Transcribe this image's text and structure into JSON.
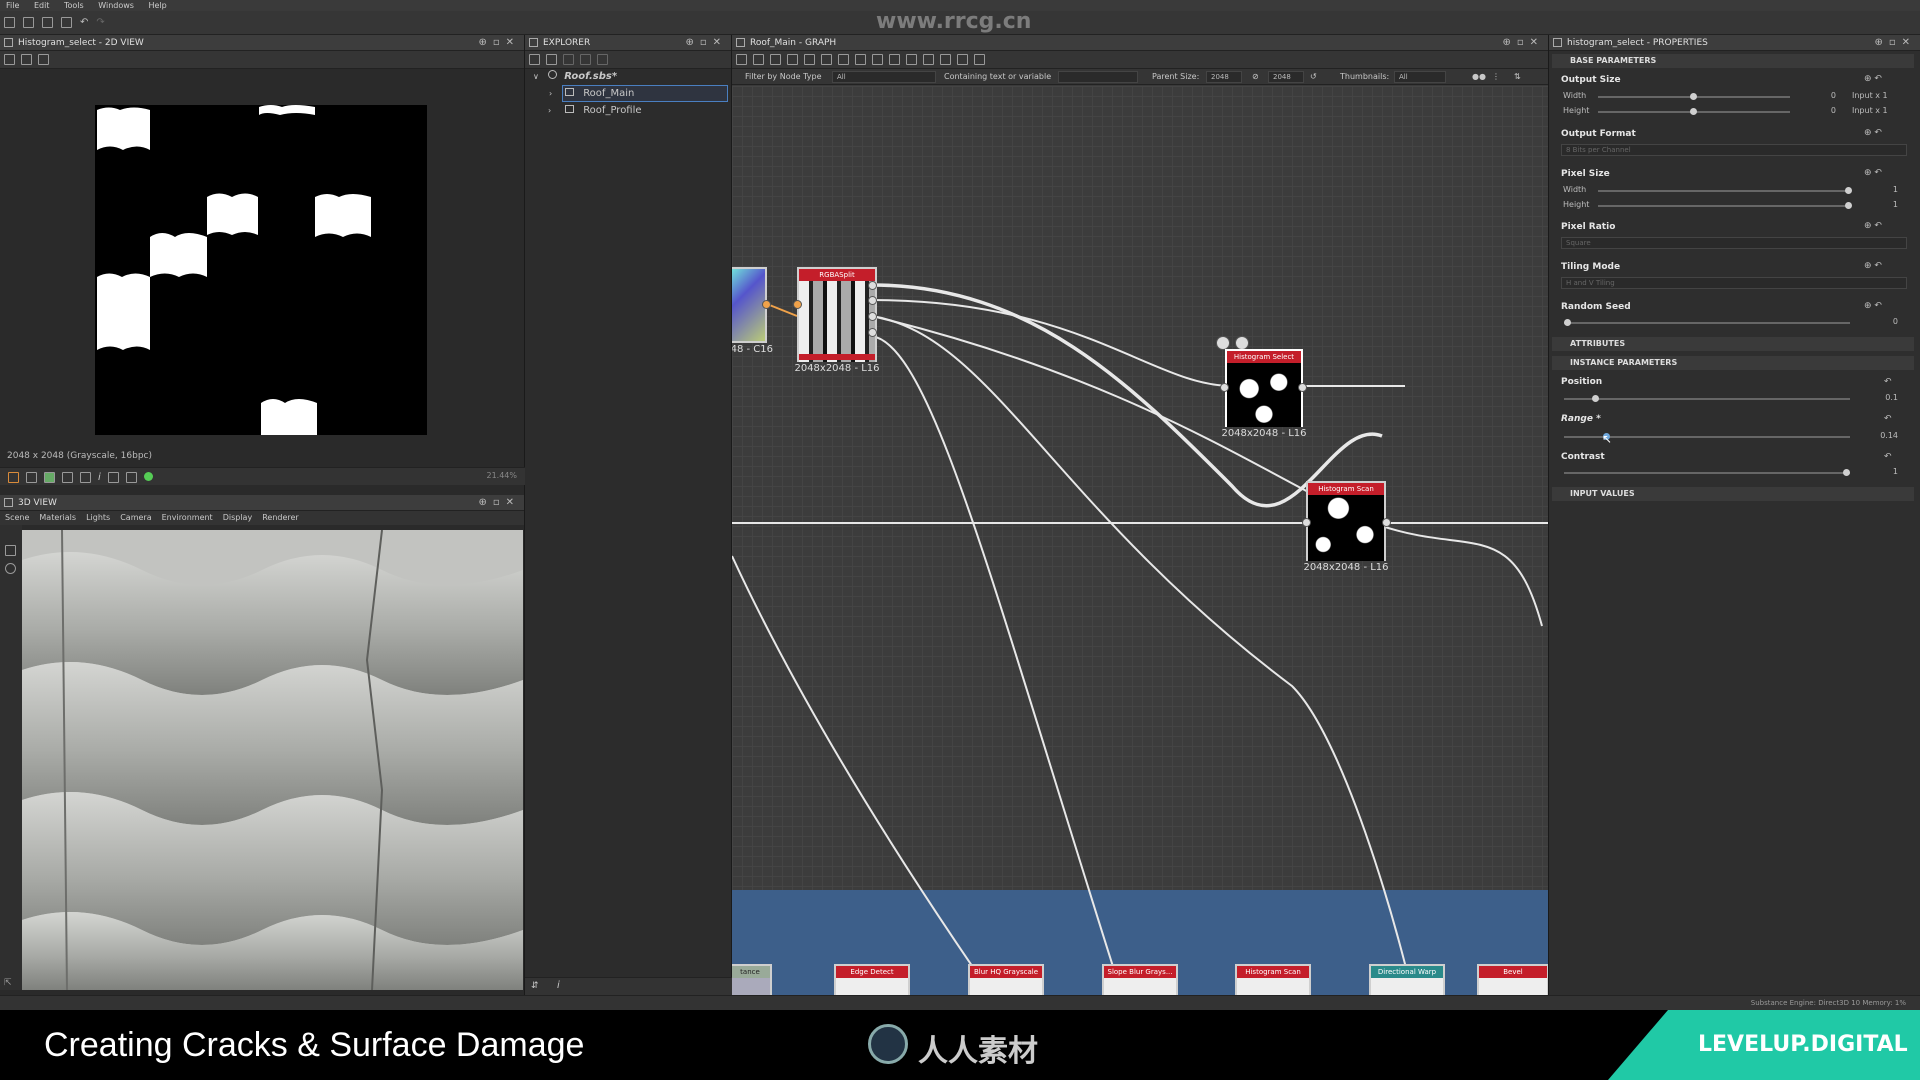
{
  "menu": [
    "File",
    "Edit",
    "Tools",
    "Windows",
    "Help"
  ],
  "watermark_site": "www.rrcg.cn",
  "view2d": {
    "title": "Histogram_select - 2D VIEW",
    "status": "2048 x 2048 (Grayscale, 16bpc)",
    "zoom": "21.44%"
  },
  "explorer": {
    "title": "EXPLORER",
    "package": "Roof.sbs*",
    "items": [
      "Roof_Main",
      "Roof_Profile"
    ]
  },
  "graph": {
    "title": "Roof_Main - GRAPH",
    "filter_label": "Filter by Node Type",
    "filter_value": "All",
    "containing_label": "Containing text or variable",
    "parent_size_label": "Parent Size:",
    "parent_size_w": "2048",
    "parent_size_h": "2048",
    "thumbnails_label": "Thumbnails:",
    "thumbnails_value": "All",
    "nodes": {
      "partial_left_label": "48 - C16",
      "rgbasplit": {
        "title": "RGBASplit",
        "label": "2048x2048 - L16"
      },
      "histogram_select": {
        "title": "Histogram Select",
        "label": "2048x2048 - L16"
      },
      "histogram_scan": {
        "title": "Histogram Scan",
        "label": "2048x2048 - L16"
      }
    },
    "bottom_nodes": [
      "tance",
      "Edge Detect",
      "Blur HQ Grayscale",
      "Slope Blur Grays...",
      "Histogram Scan",
      "Directional Warp",
      "Bevel"
    ]
  },
  "view3d": {
    "title": "3D VIEW",
    "menu": [
      "Scene",
      "Materials",
      "Lights",
      "Camera",
      "Environment",
      "Display",
      "Renderer"
    ]
  },
  "properties": {
    "title": "histogram_select - PROPERTIES",
    "sections": {
      "base": "BASE PARAMETERS",
      "attributes": "ATTRIBUTES",
      "instance": "INSTANCE PARAMETERS",
      "inputs": "INPUT VALUES"
    },
    "output_size": {
      "label": "Output Size",
      "width_label": "Width",
      "width_val": "0",
      "width_rel": "Input x 1",
      "height_label": "Height",
      "height_val": "0",
      "height_rel": "Input x 1"
    },
    "output_format": {
      "label": "Output Format",
      "value": "8 Bits per Channel"
    },
    "pixel_size": {
      "label": "Pixel Size",
      "width_label": "Width",
      "width_val": "1",
      "height_label": "Height",
      "height_val": "1"
    },
    "pixel_ratio": {
      "label": "Pixel Ratio",
      "value": "Square"
    },
    "tiling_mode": {
      "label": "Tiling Mode",
      "value": "H and V Tiling"
    },
    "random_seed": {
      "label": "Random Seed",
      "value": "0"
    },
    "instance": {
      "position_label": "Position",
      "position_val": "0.1",
      "position_level": 0.1,
      "range_label": "Range *",
      "range_val": "0.14",
      "range_level": 0.14,
      "contrast_label": "Contrast",
      "contrast_val": "1",
      "contrast_level": 1
    }
  },
  "statusbar": "Substance Engine: Direct3D 10  Memory: 1%",
  "banner": {
    "caption": "Creating Cracks & Surface Damage",
    "center_logo": "人人素材",
    "brand": "LEVELUP.DIGITAL"
  },
  "colors": {
    "node_header": "#c41e2a",
    "frame_blue": "#3d5f8a",
    "brand_teal": "#20c9a6"
  }
}
